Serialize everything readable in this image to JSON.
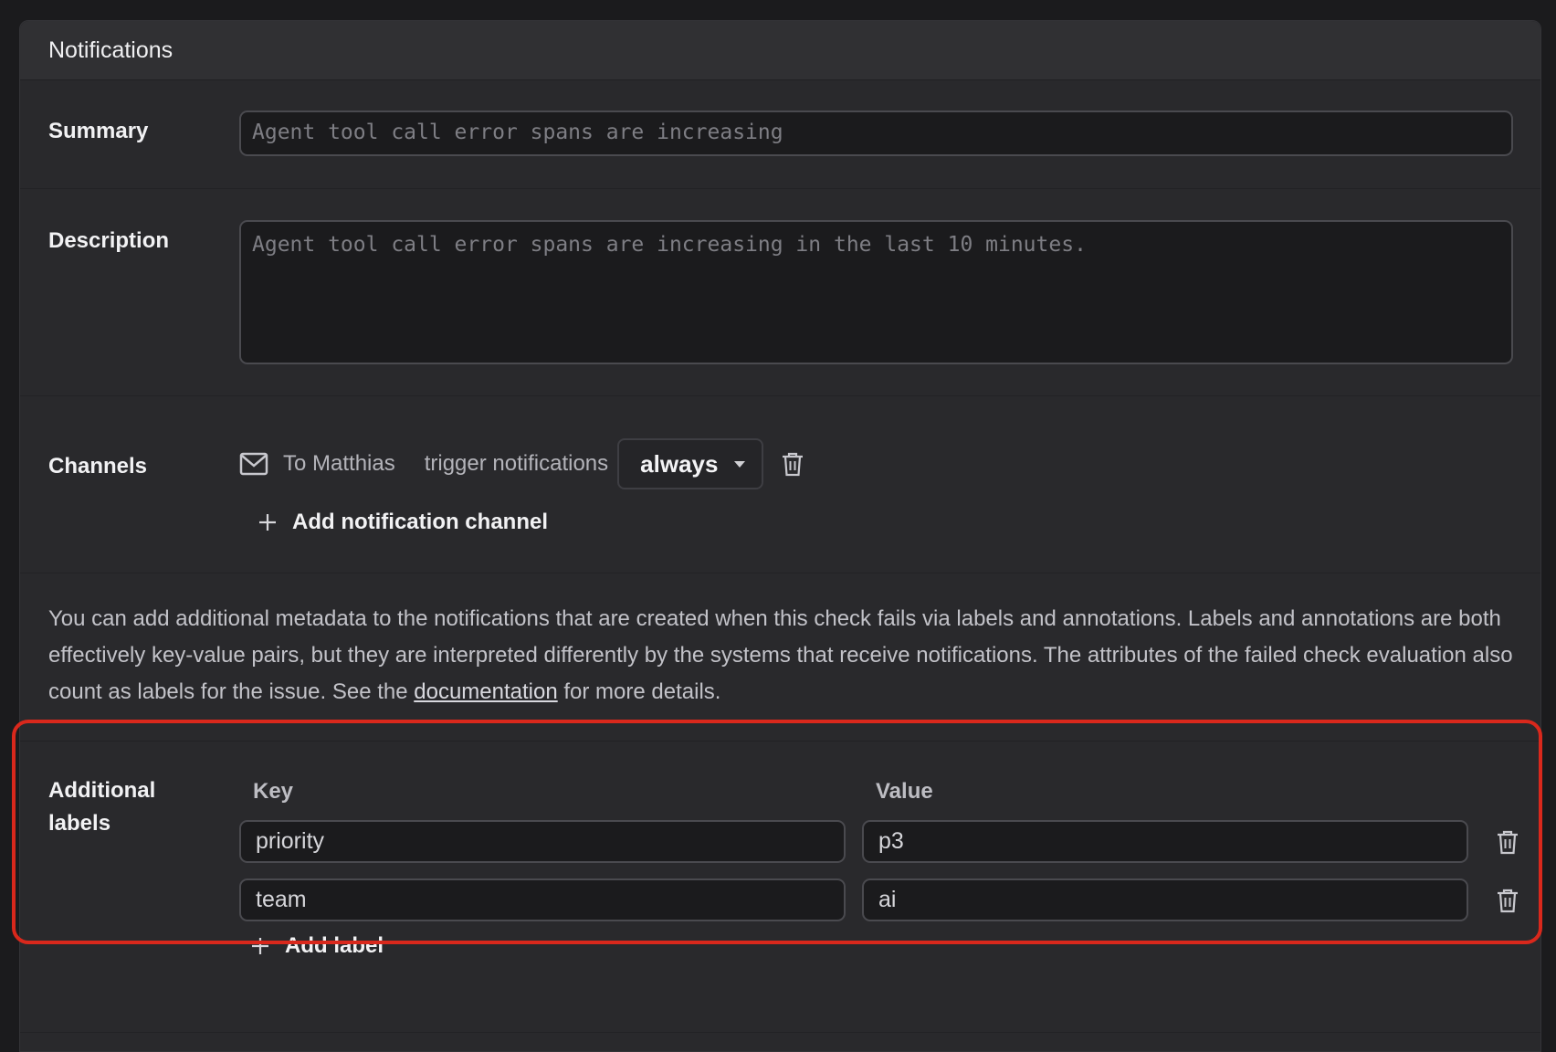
{
  "header": {
    "title": "Notifications"
  },
  "summary": {
    "label": "Summary",
    "placeholder": "Agent tool call error spans are increasing"
  },
  "description": {
    "label": "Description",
    "placeholder": "Agent tool call error spans are increasing in the last 10 minutes."
  },
  "channels": {
    "label": "Channels",
    "recipient": "To Matthias",
    "trigger_text": "trigger notifications",
    "trigger_value": "always",
    "add_label": "Add notification channel"
  },
  "info": {
    "text_before": "You can add additional metadata to the notifications that are created when this check fails via labels and annotations. Labels and annotations are both effectively key-value pairs, but they are interpreted differently by the systems that receive notifications. The attributes of the failed check evaluation also count as labels for the issue. See the ",
    "link": "documentation",
    "text_after": " for more details."
  },
  "labels": {
    "label": "Additional labels",
    "key_header": "Key",
    "value_header": "Value",
    "rows": [
      {
        "key": "priority",
        "value": "p3"
      },
      {
        "key": "team",
        "value": "ai"
      }
    ],
    "add_label": "Add label"
  },
  "colors": {
    "highlight": "#d9281c",
    "panel_bg": "#29292c",
    "input_bg": "#1b1b1d"
  }
}
